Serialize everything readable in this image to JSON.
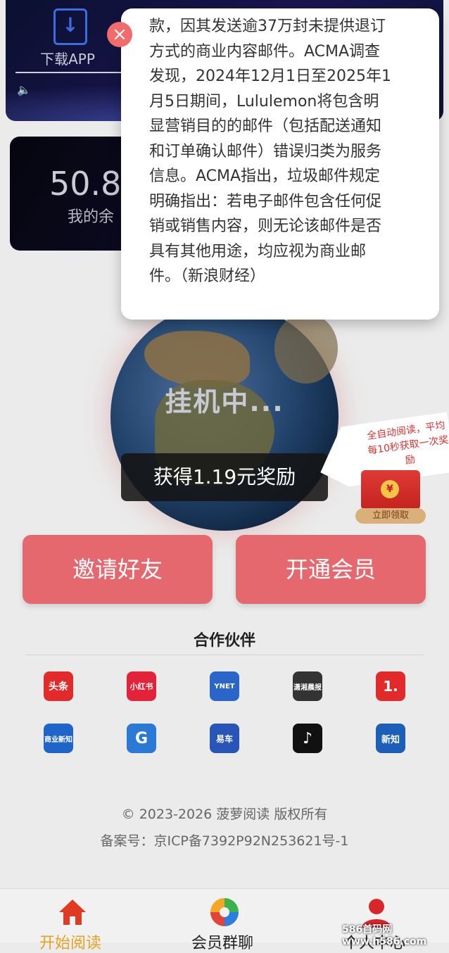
{
  "top_card": {
    "download_label": "下载APP"
  },
  "balance_card": {
    "amount": "50.8",
    "label": "我的余"
  },
  "globe": {
    "status": "挂机中..."
  },
  "reward": {
    "text": "获得1.19元奖励"
  },
  "bubble": {
    "text": "全自动阅读，平均每10秒获取一次奖励"
  },
  "red_packet": {
    "coin": "¥",
    "claim_label": "立即领取"
  },
  "actions": {
    "invite_label": "邀请好友",
    "vip_label": "开通会员"
  },
  "partners": {
    "title": "合作伙伴",
    "logos": [
      {
        "name": "toutiao",
        "text": "头条",
        "color": "#e22a2a"
      },
      {
        "name": "xiaohongshu",
        "text": "小红书",
        "color": "#e2233a"
      },
      {
        "name": "ynet",
        "text": "YNET",
        "color": "#2a66c9"
      },
      {
        "name": "xiaoxiang-morning",
        "text": "潇湘晨报",
        "color": "#333333"
      },
      {
        "name": "yidian",
        "text": "1.",
        "color": "#e22a2a"
      },
      {
        "name": "shangye-xinzhi",
        "text": "商业新知",
        "color": "#1f64c9"
      },
      {
        "name": "g-app",
        "text": "G",
        "color": "#2a79d4"
      },
      {
        "name": "yidong-qiche",
        "text": "易车",
        "color": "#2a55b8"
      },
      {
        "name": "douyin",
        "text": "♪",
        "color": "#111111"
      },
      {
        "name": "xinzhi",
        "text": "新知",
        "color": "#1b5fb8"
      }
    ]
  },
  "footer": {
    "copyright": "© 2023-2026 菠萝阅读 版权所有",
    "icp": "备案号：京ICP备7392P92N253621号-1"
  },
  "tabbar": {
    "items": [
      {
        "label": "开始阅读",
        "color": "#e6a21f"
      },
      {
        "label": "会员群聊",
        "color": "#222222"
      },
      {
        "label": "个人中心",
        "color": "#222222"
      }
    ]
  },
  "watermark": "586首码网 www.h586.com",
  "modal": {
    "close_glyph": "×",
    "lines": [
      "款，因其发送逾37万封未提供退订",
      "方式的商业内容邮件。ACMA调查",
      "发现，2024年12月1日至2025年1",
      "月5日期间，Lululemon将包含明",
      "显营销目的的邮件（包括配送通知",
      "和订单确认邮件）错误归类为服务",
      "信息。ACMA指出，垃圾邮件规定",
      "明确指出：若电子邮件包含任何促",
      "销或销售内容，则无论该邮件是否",
      "具有其他用途，均应视为商业邮",
      "件。（新浪财经）"
    ]
  }
}
